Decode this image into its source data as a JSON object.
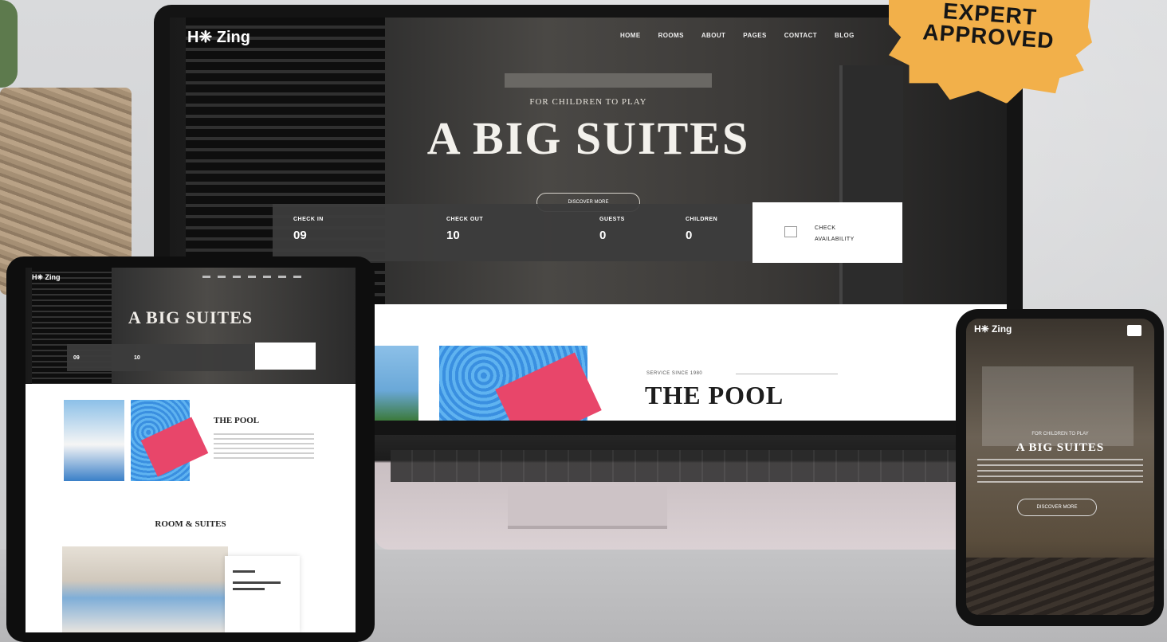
{
  "laptop": {
    "logo": "H❈ Zing",
    "nav": [
      "HOME",
      "ROOMS",
      "ABOUT",
      "PAGES",
      "CONTACT",
      "BLOG"
    ],
    "hero": {
      "eyebrow": "FOR CHILDREN TO PLAY",
      "title": "A BIG SUITES",
      "cta": "DISCOVER MORE"
    },
    "booking": {
      "checkin_label": "CHECK IN",
      "checkin_day": "09",
      "checkout_label": "CHECK OUT",
      "checkout_day": "10",
      "guests_label": "GUESTS",
      "guests_value": "0",
      "children_label": "CHILDREN",
      "children_value": "0",
      "check_line1": "CHECK",
      "check_line2": "AVAILABILITY"
    },
    "pool": {
      "eyebrow": "SERVICE SINCE 1980",
      "title": "THE POOL"
    }
  },
  "badge": {
    "line1": "EXPERT",
    "line2": "APPROVED",
    "color": "#f2b04a"
  },
  "tablet": {
    "logo": "H❈ Zing",
    "hero_title": "A BIG SUITES",
    "booking_day1": "09",
    "booking_day2": "10",
    "pool_title": "THE POOL",
    "rooms_title": "ROOM & SUITES"
  },
  "phone": {
    "logo": "H❈ Zing",
    "hero_eyebrow": "FOR CHILDREN TO PLAY",
    "hero_title": "A BIG SUITES",
    "cta": "DISCOVER MORE"
  }
}
